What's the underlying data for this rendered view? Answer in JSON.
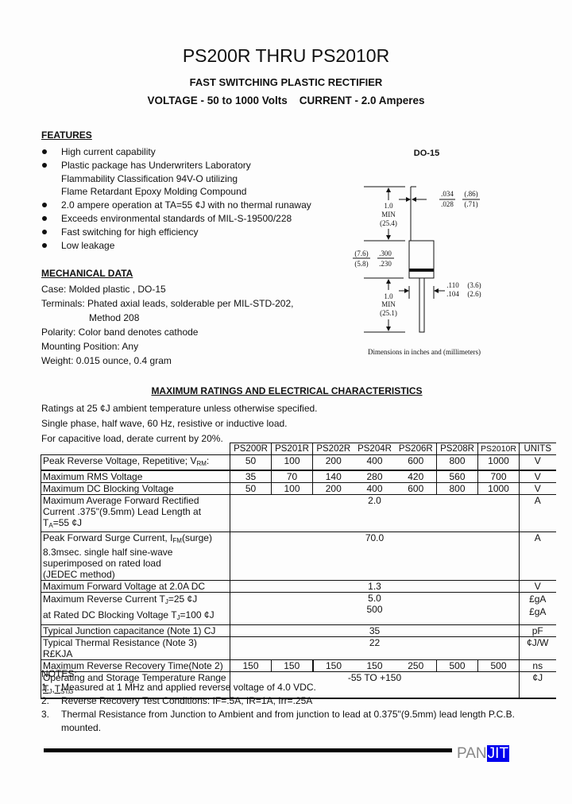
{
  "header": {
    "title": "PS200R THRU PS2010R",
    "subtitle": "FAST SWITCHING PLASTIC RECTIFIER",
    "voltage_current": "VOLTAGE - 50 to 1000 Volts    CURRENT - 2.0 Amperes"
  },
  "features": {
    "heading": "FEATURES",
    "items": [
      {
        "lines": [
          "High current capability"
        ]
      },
      {
        "lines": [
          "Plastic package has Underwriters Laboratory",
          "Flammability Classification 94V-O utilizing",
          "Flame Retardant Epoxy Molding Compound"
        ]
      },
      {
        "lines": [
          "2.0 ampere operation at TA=55 ¢J  with no thermal runaway"
        ]
      },
      {
        "lines": [
          "Exceeds environmental standards of MIL-S-19500/228"
        ]
      },
      {
        "lines": [
          "Fast switching for high efficiency"
        ]
      },
      {
        "lines": [
          "Low leakage"
        ]
      }
    ]
  },
  "mechanical": {
    "heading": "MECHANICAL DATA",
    "lines": [
      "Case: Molded plastic , DO-15",
      "Terminals: Phated axial leads, solderable per MIL-STD-202,",
      "Method 208",
      "Polarity: Color band denotes cathode",
      "Mounting Position: Any",
      "Weight: 0.015 ounce, 0.4 gram"
    ]
  },
  "diagram": {
    "package": "DO-15",
    "lead_length_top": [
      "1.0",
      "MIN",
      "(25.4)"
    ],
    "lead_dia_in": [
      ".034",
      ".028"
    ],
    "lead_dia_mm": [
      "(.86)",
      "(.71)"
    ],
    "body_len_mm": [
      "(7.6)",
      "(5.8)"
    ],
    "body_len_in": [
      ".300",
      ".230"
    ],
    "body_dia_in": [
      ".110",
      ".104"
    ],
    "body_dia_mm": [
      "(3.6)",
      "(2.6)"
    ],
    "lead_length_bottom": [
      "1.0",
      "MIN",
      "(25.1)"
    ],
    "caption": "Dimensions in inches and (millimeters)"
  },
  "ratings": {
    "heading": "MAXIMUM RATINGS AND ELECTRICAL CHARACTERISTICS",
    "conditions": [
      "Ratings at 25 ¢J  ambient temperature unless otherwise specified.",
      "Single phase, half wave, 60 Hz, resistive or inductive load.",
      "For capacitive load, derate current by 20%."
    ],
    "columns": [
      "PS200R",
      "PS201R",
      "PS202R",
      "PS204R",
      "PS206R",
      "PS208R",
      "PS2010R",
      "UNITS"
    ],
    "rows": {
      "vrrm": {
        "label": "Peak Reverse Voltage, Repetitive; V",
        "sub": "RM",
        "suffix": ":",
        "values": [
          "50",
          "100",
          "200",
          "400",
          "600",
          "800",
          "1000"
        ],
        "unit": "V"
      },
      "vrms": {
        "label": "Maximum RMS Voltage",
        "values": [
          "35",
          "70",
          "140",
          "280",
          "420",
          "560",
          "700"
        ],
        "unit": "V"
      },
      "vdc": {
        "label": "Maximum DC Blocking Voltage",
        "values": [
          "50",
          "100",
          "200",
          "400",
          "600",
          "800",
          "1000"
        ],
        "unit": "V"
      },
      "iav": {
        "lines": [
          "Maximum Average Forward Rectified",
          "Current .375\"(9.5mm) Lead Length at"
        ],
        "line3": "=55 ¢J",
        "value": "2.0",
        "unit": "A"
      },
      "ifsm": {
        "line1": "Peak Forward Surge Current, I",
        "line1_sub": "FM",
        "line1_end": "(surge)",
        "lines": [
          "8.3msec. single half sine-wave",
          "superimposed on rated load",
          "(JEDEC method)"
        ],
        "value": "70.0",
        "unit": "A"
      },
      "vf": {
        "label": "Maximum Forward Voltage at 2.0A DC",
        "value": "1.3",
        "unit": "V"
      },
      "ir": {
        "line1": "Maximum Reverse Current    T",
        "line1_end": "=25 ¢J",
        "line2": "at Rated DC Blocking Voltage T",
        "line2_end": "=100 ¢J",
        "value1": "5.0",
        "value2": "500",
        "unit1": "£gA",
        "unit2": "£gA"
      },
      "cj": {
        "label": "Typical Junction capacitance (Note 1) CJ",
        "value": "35",
        "unit": "pF"
      },
      "rth": {
        "label": "Typical Thermal Resistance (Note 3) R£KJA",
        "value": "22",
        "unit": "¢J/W"
      },
      "trr": {
        "label": "Maximum Reverse Recovery Time(Note 2)",
        "values": [
          "150",
          "150",
          "150",
          "150",
          "250",
          "500",
          "500"
        ],
        "unit": "ns"
      },
      "temp": {
        "label": "Operating and Storage Temperature Range",
        "line2": "T",
        "line2_mid": ",T",
        "value": "-55 TO +150",
        "unit": "¢J"
      }
    }
  },
  "notes": {
    "heading": "NOTES:",
    "items": [
      {
        "num": "1.",
        "text": "Measured at 1 MHz and applied reverse voltage of 4.0 VDC."
      },
      {
        "num": "2.",
        "text": "Reverse Recovery Test Conditions: IF=.5A, IR=1A, Irr=.25A"
      },
      {
        "num": "3.",
        "text": "Thermal Resistance from Junction to Ambient and from junction to lead at 0.375\"(9.5mm) lead length P.C.B.",
        "text2": "mounted."
      }
    ]
  },
  "footer": {
    "logo_left": "PAN",
    "logo_right": "JIT",
    "logo_accent": "#0000ee"
  }
}
